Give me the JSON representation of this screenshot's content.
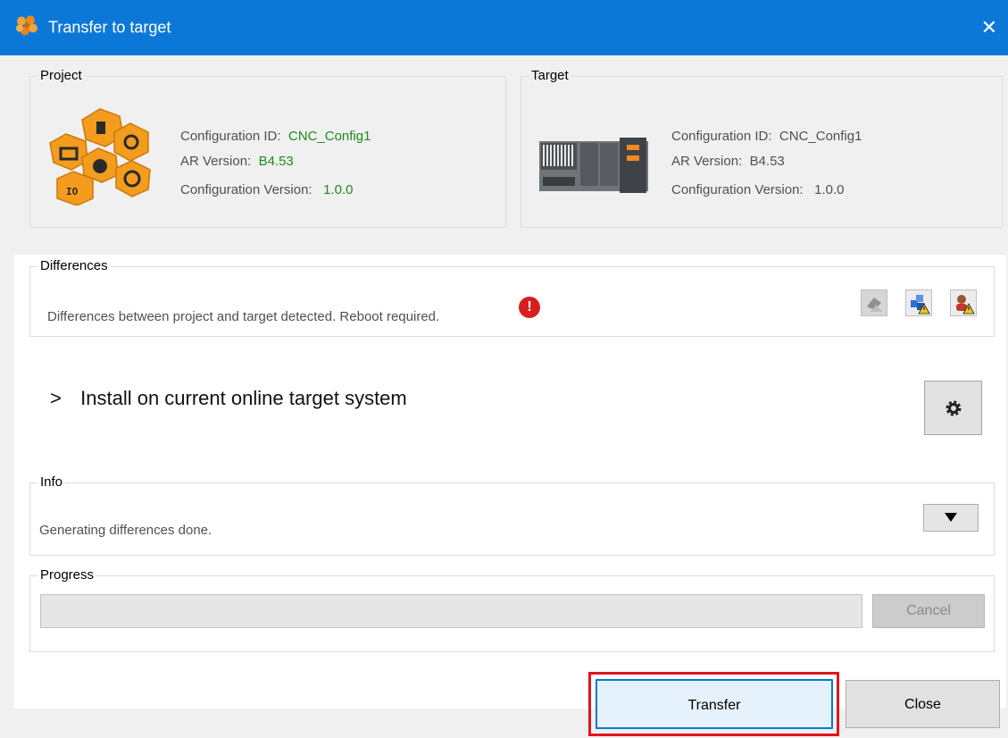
{
  "window": {
    "title": "Transfer to target",
    "close_glyph": "✕"
  },
  "project": {
    "group_label": "Project",
    "config_id_label": "Configuration ID:",
    "config_id_value": "CNC_Config1",
    "ar_version_label": "AR Version:",
    "ar_version_value": "B4.53",
    "config_version_label": "Configuration Version:",
    "config_version_value": "1.0.0",
    "icon": "project-hexagon-cluster-icon"
  },
  "target": {
    "group_label": "Target",
    "config_id_label": "Configuration ID:",
    "config_id_value": "CNC_Config1",
    "ar_version_label": "AR Version:",
    "ar_version_value": "B4.53",
    "config_version_label": "Configuration Version:",
    "config_version_value": "1.0.0",
    "icon": "plc-hardware-icon"
  },
  "differences": {
    "group_label": "Differences",
    "message": "Differences between project and target detected. Reboot required.",
    "status_icon": "error-exclamation-icon",
    "tools": [
      "eraser-warning-icon",
      "cubes-warning-icon",
      "user-warning-icon"
    ]
  },
  "install": {
    "chevron": ">",
    "label": "Install on current online target system",
    "settings_icon": "gear-icon"
  },
  "info": {
    "group_label": "Info",
    "message": "Generating differences done.",
    "dropdown_icon": "triangle-down-icon"
  },
  "progress": {
    "group_label": "Progress",
    "value": 0,
    "cancel_label": "Cancel"
  },
  "buttons": {
    "transfer_label": "Transfer",
    "close_label": "Close"
  },
  "colors": {
    "title_bar": "#0b78d7",
    "accent_green": "#1e8a1e",
    "highlight_red": "#e0141e",
    "focus_blue": "#0078d7"
  }
}
